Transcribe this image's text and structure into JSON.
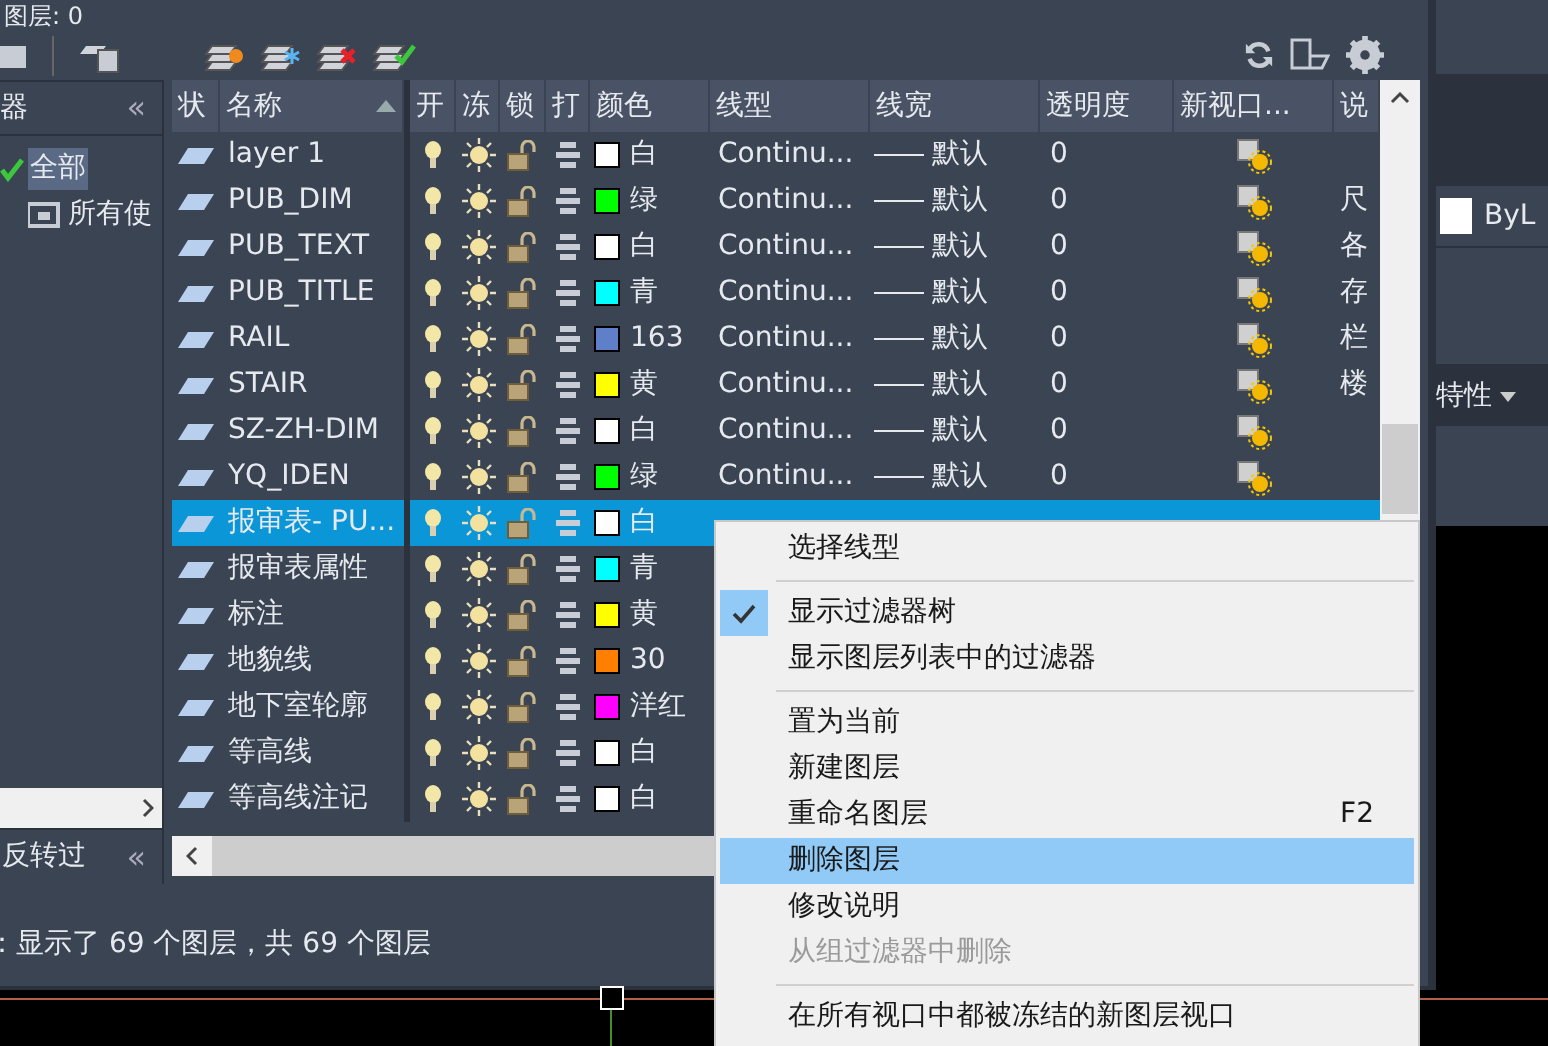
{
  "header": {
    "current_layer": "图层: 0"
  },
  "filter_panel": {
    "title": "器",
    "collapse_glyph": "«",
    "invert_collapse_glyph": "«",
    "tree": [
      {
        "label": "全部",
        "selected": true,
        "children": [
          {
            "label": "所有使",
            "selected": false
          }
        ]
      }
    ],
    "invert_label": "反转过"
  },
  "table": {
    "columns": [
      "状",
      "名称",
      "开",
      "冻",
      "锁",
      "打",
      "颜色",
      "线型",
      "线宽",
      "透明度",
      "新视口...",
      "说"
    ],
    "rows": [
      {
        "name": "layer 1",
        "selected": false,
        "color": "#ffffff",
        "color_label": "白",
        "linetype": "Continu...",
        "lineweight": "默认",
        "transparency": "0"
      },
      {
        "name": "PUB_DIM",
        "selected": false,
        "color": "#00ff00",
        "color_label": "绿",
        "linetype": "Continu...",
        "lineweight": "默认",
        "transparency": "0",
        "description": "尺"
      },
      {
        "name": "PUB_TEXT",
        "selected": false,
        "color": "#ffffff",
        "color_label": "白",
        "linetype": "Continu...",
        "lineweight": "默认",
        "transparency": "0",
        "description": "各"
      },
      {
        "name": "PUB_TITLE",
        "selected": false,
        "color": "#00ffff",
        "color_label": "青",
        "linetype": "Continu...",
        "lineweight": "默认",
        "transparency": "0",
        "description": "存"
      },
      {
        "name": "RAIL",
        "selected": false,
        "color": "#5f7fc8",
        "color_label": "163",
        "linetype": "Continu...",
        "lineweight": "默认",
        "transparency": "0",
        "description": "栏"
      },
      {
        "name": "STAIR",
        "selected": false,
        "color": "#ffff00",
        "color_label": "黄",
        "linetype": "Continu...",
        "lineweight": "默认",
        "transparency": "0",
        "description": "楼"
      },
      {
        "name": "SZ-ZH-DIM",
        "selected": false,
        "color": "#ffffff",
        "color_label": "白",
        "linetype": "Continu...",
        "lineweight": "默认",
        "transparency": "0"
      },
      {
        "name": "YQ_IDEN",
        "selected": false,
        "color": "#00ff00",
        "color_label": "绿",
        "linetype": "Continu...",
        "lineweight": "默认",
        "transparency": "0"
      },
      {
        "name": "报审表- PU...",
        "selected": true,
        "color": "#ffffff",
        "color_label": "白"
      },
      {
        "name": "报审表属性",
        "selected": false,
        "color": "#00ffff",
        "color_label": "青"
      },
      {
        "name": "标注",
        "selected": false,
        "color": "#ffff00",
        "color_label": "黄"
      },
      {
        "name": "地貌线",
        "selected": false,
        "color": "#ff8000",
        "color_label": "30"
      },
      {
        "name": "地下室轮廓",
        "selected": false,
        "color": "#ff00ff",
        "color_label": "洋红"
      },
      {
        "name": "等高线",
        "selected": false,
        "color": "#ffffff",
        "color_label": "白"
      },
      {
        "name": "等高线注记",
        "selected": false,
        "color": "#ffffff",
        "color_label": "白"
      }
    ]
  },
  "status_bar": "：显示了 69 个图层，共 69 个图层",
  "context_menu": {
    "items": [
      {
        "kind": "item",
        "label": "选择线型",
        "checked": false,
        "selected": false,
        "disabled": false
      },
      {
        "kind": "separator"
      },
      {
        "kind": "item",
        "label": "显示过滤器树",
        "checked": true,
        "selected": false,
        "disabled": false
      },
      {
        "kind": "item",
        "label": "显示图层列表中的过滤器",
        "checked": false,
        "selected": false,
        "disabled": false
      },
      {
        "kind": "separator"
      },
      {
        "kind": "item",
        "label": "置为当前",
        "checked": false,
        "selected": false,
        "disabled": false
      },
      {
        "kind": "item",
        "label": "新建图层",
        "checked": false,
        "selected": false,
        "disabled": false
      },
      {
        "kind": "item",
        "label": "重命名图层",
        "shortcut": "F2",
        "checked": false,
        "selected": false,
        "disabled": false
      },
      {
        "kind": "item",
        "label": "删除图层",
        "checked": false,
        "selected": true,
        "disabled": false
      },
      {
        "kind": "item",
        "label": "修改说明",
        "checked": false,
        "selected": false,
        "disabled": false
      },
      {
        "kind": "item",
        "label": "从组过滤器中删除",
        "checked": false,
        "selected": false,
        "disabled": true
      },
      {
        "kind": "separator"
      },
      {
        "kind": "item",
        "label": "在所有视口中都被冻结的新图层视口",
        "checked": false,
        "selected": false,
        "disabled": false
      }
    ]
  },
  "properties_panel": {
    "color_label": "ByL",
    "section_title": "特性"
  }
}
